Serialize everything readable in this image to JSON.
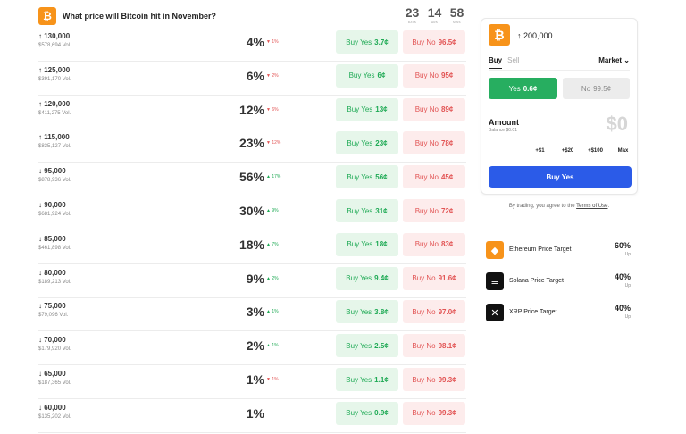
{
  "header": {
    "title": "What price will Bitcoin hit in November?",
    "countdown": [
      {
        "value": "23",
        "label": "DAYS"
      },
      {
        "value": "14",
        "label": "HRS"
      },
      {
        "value": "58",
        "label": "MINS"
      }
    ]
  },
  "rows": [
    {
      "name": "↑ 130,000",
      "vol": "$578,694 Vol.",
      "pct": "4%",
      "chg": "▼ 1%",
      "dir": "down",
      "yes_label": "Buy Yes",
      "yes_price": "3.7¢",
      "no_label": "Buy No",
      "no_price": "96.5¢"
    },
    {
      "name": "↑ 125,000",
      "vol": "$391,170 Vol.",
      "pct": "6%",
      "chg": "▼ 2%",
      "dir": "down",
      "yes_label": "Buy Yes",
      "yes_price": "6¢",
      "no_label": "Buy No",
      "no_price": "95¢"
    },
    {
      "name": "↑ 120,000",
      "vol": "$411,275 Vol.",
      "pct": "12%",
      "chg": "▼ 6%",
      "dir": "down",
      "yes_label": "Buy Yes",
      "yes_price": "13¢",
      "no_label": "Buy No",
      "no_price": "89¢"
    },
    {
      "name": "↑ 115,000",
      "vol": "$835,127 Vol.",
      "pct": "23%",
      "chg": "▼ 12%",
      "dir": "down",
      "yes_label": "Buy Yes",
      "yes_price": "23¢",
      "no_label": "Buy No",
      "no_price": "78¢"
    },
    {
      "name": "↓ 95,000",
      "vol": "$878,936 Vol.",
      "pct": "56%",
      "chg": "▲ 17%",
      "dir": "up",
      "yes_label": "Buy Yes",
      "yes_price": "56¢",
      "no_label": "Buy No",
      "no_price": "45¢"
    },
    {
      "name": "↓ 90,000",
      "vol": "$681,924 Vol.",
      "pct": "30%",
      "chg": "▲ 9%",
      "dir": "up",
      "yes_label": "Buy Yes",
      "yes_price": "31¢",
      "no_label": "Buy No",
      "no_price": "72¢"
    },
    {
      "name": "↓ 85,000",
      "vol": "$461,898 Vol.",
      "pct": "18%",
      "chg": "▲ 7%",
      "dir": "up",
      "yes_label": "Buy Yes",
      "yes_price": "18¢",
      "no_label": "Buy No",
      "no_price": "83¢"
    },
    {
      "name": "↓ 80,000",
      "vol": "$189,213 Vol.",
      "pct": "9%",
      "chg": "▲ 2%",
      "dir": "up",
      "yes_label": "Buy Yes",
      "yes_price": "9.4¢",
      "no_label": "Buy No",
      "no_price": "91.6¢"
    },
    {
      "name": "↓ 75,000",
      "vol": "$79,096 Vol.",
      "pct": "3%",
      "chg": "▲ 1%",
      "dir": "up",
      "yes_label": "Buy Yes",
      "yes_price": "3.8¢",
      "no_label": "Buy No",
      "no_price": "97.0¢"
    },
    {
      "name": "↓ 70,000",
      "vol": "$179,920 Vol.",
      "pct": "2%",
      "chg": "▲ 1%",
      "dir": "up",
      "yes_label": "Buy Yes",
      "yes_price": "2.5¢",
      "no_label": "Buy No",
      "no_price": "98.1¢"
    },
    {
      "name": "↓ 65,000",
      "vol": "$187,365 Vol.",
      "pct": "1%",
      "chg": "▼ 1%",
      "dir": "down",
      "yes_label": "Buy Yes",
      "yes_price": "1.1¢",
      "no_label": "Buy No",
      "no_price": "99.3¢"
    },
    {
      "name": "↓ 60,000",
      "vol": "$135,202 Vol.",
      "pct": "1%",
      "chg": "",
      "dir": "none",
      "yes_label": "Buy Yes",
      "yes_price": "0.9¢",
      "no_label": "Buy No",
      "no_price": "99.3¢"
    }
  ],
  "panel": {
    "title": "↑ 200,000",
    "tab_buy": "Buy",
    "tab_sell": "Sell",
    "order_type": "Market",
    "yes_label": "Yes",
    "yes_price": "0.6¢",
    "no_label": "No",
    "no_price": "99.5¢",
    "amount_label": "Amount",
    "balance": "Balance $0.01",
    "amount_value": "$0",
    "quick": [
      "+$1",
      "+$20",
      "+$100",
      "Max"
    ],
    "buy_button": "Buy Yes",
    "terms_prefix": "By trading, you agree to the ",
    "terms_link": "Terms of Use",
    "terms_suffix": "."
  },
  "related": [
    {
      "name": "Ethereum Price Target",
      "pct": "60%",
      "dir": "Up",
      "icon": "ethereum-icon",
      "color": "#f7931a"
    },
    {
      "name": "Solana Price Target",
      "pct": "40%",
      "dir": "Up",
      "icon": "solana-icon",
      "color": "#111111"
    },
    {
      "name": "XRP Price Target",
      "pct": "40%",
      "dir": "Up",
      "icon": "xrp-icon",
      "color": "#111111"
    }
  ],
  "colors": {
    "bitcoin": "#f7931a",
    "yes_green": "#1faa55",
    "no_red": "#e25454",
    "buy_blue": "#2b5be8"
  }
}
